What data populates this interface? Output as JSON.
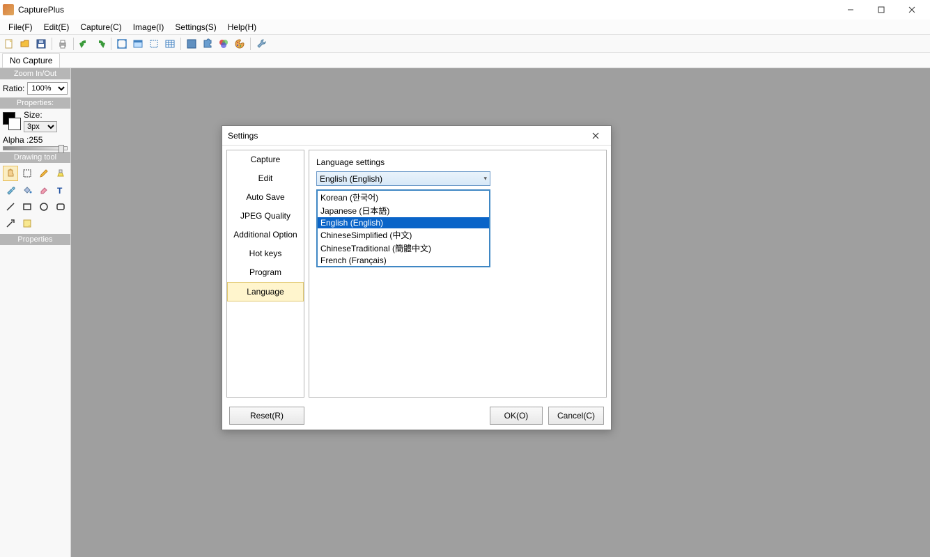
{
  "titlebar": {
    "title": "CapturePlus"
  },
  "menu": {
    "file": "File(F)",
    "edit": "Edit(E)",
    "capture": "Capture(C)",
    "image": "Image(I)",
    "settings": "Settings(S)",
    "help": "Help(H)"
  },
  "tabbar": {
    "tab0": "No Capture"
  },
  "sidebar": {
    "zoom_header": "Zoom In/Out",
    "ratio_label": "Ratio:",
    "ratio_value": "100%",
    "properties_header": "Properties:",
    "size_label": "Size:",
    "size_value": "3px",
    "alpha_label": "Alpha :255",
    "drawing_header": "Drawing tool",
    "properties2_header": "Properties"
  },
  "dialog": {
    "title": "Settings",
    "nav": {
      "capture": "Capture",
      "edit": "Edit",
      "autosave": "Auto Save",
      "jpeg": "JPEG Quality",
      "additional": "Additional Option",
      "hotkeys": "Hot keys",
      "program": "Program",
      "language": "Language"
    },
    "lang_label": "Language settings",
    "lang_selected": "English (English)",
    "lang_options": {
      "ko": "Korean (한국어)",
      "ja": "Japanese (日本語)",
      "en": "English (English)",
      "zh_s": "ChineseSimplified (中文)",
      "zh_t": "ChineseTraditional (簡體中文)",
      "fr": "French (Français)"
    },
    "buttons": {
      "reset": "Reset(R)",
      "ok": "OK(O)",
      "cancel": "Cancel(C)"
    }
  }
}
